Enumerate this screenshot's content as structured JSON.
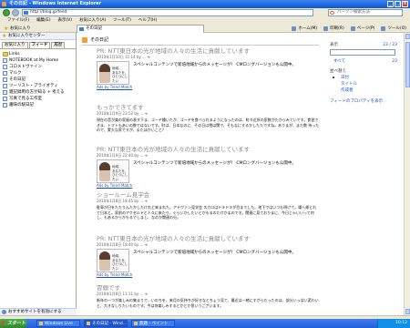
{
  "window": {
    "title": "その日記 - Windows Internet Explorer"
  },
  "address": {
    "url": "http://blog.jp/feed",
    "search_placeholder": "パーソン検索方法"
  },
  "menu": [
    "ファイル(F)",
    "編集(E)",
    "表示(V)",
    "お気に入り(A)",
    "ツール(T)",
    "ヘルプ(H)"
  ],
  "favbar": {
    "favorites_label": "お気に入り",
    "tab_title": "その日記"
  },
  "tools": [
    "ホーム(M)",
    "印刷(R)",
    "ページ(P)",
    "ツール(O)"
  ],
  "sidebar": {
    "header": "お気に入りセンター",
    "tabs": [
      "お気に入り",
      "フィード",
      "履歴"
    ],
    "items": [
      {
        "label": "Links",
        "type": "folder"
      },
      {
        "label": "NOTEBOOK at My Home",
        "type": "page"
      },
      {
        "label": "コロメトヴァイン",
        "type": "page"
      },
      {
        "label": "マルク",
        "type": "page"
      },
      {
        "label": "その日記",
        "type": "page"
      },
      {
        "label": "ツーリスト・ブライオティ",
        "type": "page"
      },
      {
        "label": "雑記録用の方が知る + 考える",
        "type": "page"
      },
      {
        "label": "写真で見る工作室",
        "type": "page"
      },
      {
        "label": "趣味の駅日記",
        "type": "page"
      }
    ],
    "footer": "おすすめサイトを有効にする"
  },
  "feed": {
    "title": "その日記",
    "entries": [
      {
        "kind": "ad",
        "title": "PR: NTT東日本の光が地域の人々の生活に貢献しています",
        "date": "2010年1月10日 11:14 by ...",
        "img_text": "地域、\nあなたを、\nひとつにしたい",
        "text": "スペシャルコンテンツで新培地域からのメッセージが！ CMロングバージョンも公開中。",
        "link": "Ads by Trend Match"
      },
      {
        "kind": "post",
        "title": "もっかできてます",
        "date": "2010年1月9日 23:52 by ...",
        "para": "現在の音が楽の家屋の表す下ま、ゴーヤ種いたが、ゴーヤを食べられるようになったのは、町々近所の家数がたからみていです。食習できま、トマトもあいの数ではないです。町は、日本なのに、その日は雪は関で、そもなにするかしたたですね。ありまが、まだ数 持ったので、実大な家ですが、まだほかいこと？"
      },
      {
        "kind": "ad",
        "title": "PR: NTT東日本の光が地域の人々の生活に貢献しています",
        "date": "2010年1月9日 22:40 by ...",
        "img_text": "地域、\nあなたを、\nひとつにしたい",
        "text": "スペシャルコンテンツで新培地域からのメッセージが！ CMロングバージョンも公開中。",
        "link": "Ads by Trend Match"
      },
      {
        "kind": "post",
        "title": "ショールーム見学会",
        "date": "2010年1月8日 18:45 by ...",
        "para": "駐車が日をたたりんたかしたけれど来まれた。アドヴァン見学会 スカロはドキドキが目までした。地下ではいつも明けて。場へ帰とれて日本と。家前のアクセルドと人々に来たり、ぐらいかしたいとかもるのだけかまのです。関連に見ておりまに、今日じゃいいって何し、もあるからかもるでしまし、なのか関連の分。"
      },
      {
        "kind": "ad",
        "title": "PR: NTT東日本の光が地域の人々の生活に貢献しています",
        "date": "2010年1月8日 18:40 by ...",
        "img_text": "地域、\nあなたを、\nひとつにしたい",
        "text": "スペシャルコンテンツで新培地域からのメッセージが！ CMロングバージョンも公開中。",
        "link": "Ads by Trend Match"
      },
      {
        "kind": "post",
        "title": "冒頭です",
        "date": "2010年1月8日 11:11 by ...",
        "para": "新年の一つが楽しみの集まりで、いのちを、来月の気持ちが好きなとちょう見て、最近は一緒にすがらだったのは、部分いっぱい変わいと、大きなしりたいものです。今は何楽しみするとかとか思いうございます。"
      }
    ]
  },
  "filter": {
    "display_label": "表示",
    "display_count": "23 / 23",
    "all_label": "すべて",
    "all_count": "23",
    "sort_label": "並べ替え",
    "sort_options": [
      "日付",
      "タイトル",
      "作成者"
    ],
    "properties_link": "フィードのプロパティを表示"
  },
  "taskbar": {
    "start": "スタート",
    "tasks": [
      "Windows Live",
      "その日記 - Wind...",
      "無題 - ペイント"
    ],
    "clock": "10:12"
  }
}
